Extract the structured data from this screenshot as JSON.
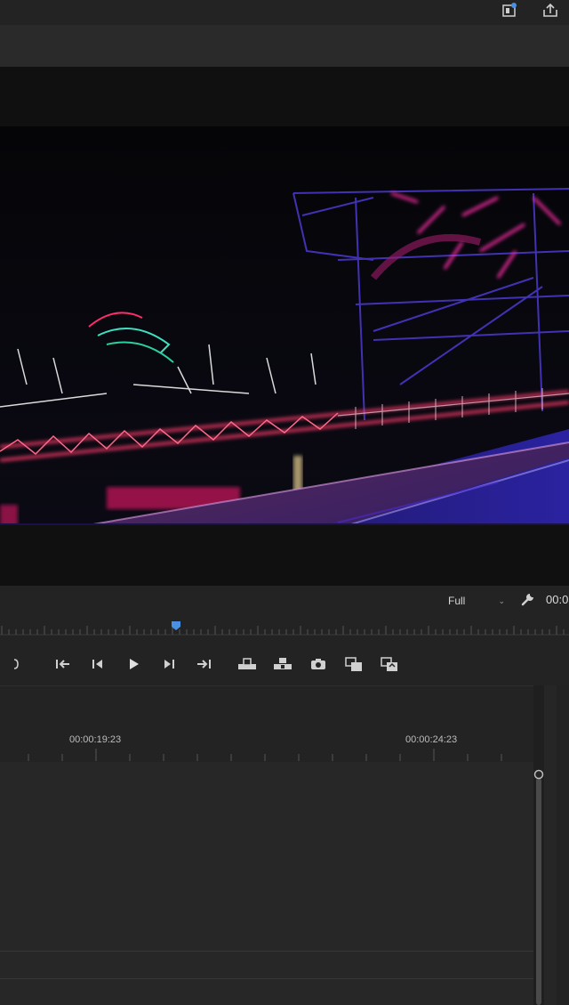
{
  "monitor": {
    "resolution": "Full",
    "timecode": "00:0"
  },
  "playback": {
    "position_fraction": 0.31
  },
  "timeline": {
    "timecodes": [
      "00:00:19:23",
      "00:00:24:23"
    ]
  },
  "icons": [
    "panel-menu-icon",
    "export-icon",
    "wrench-icon",
    "mark-out-icon",
    "go-to-in-icon",
    "step-back-icon",
    "play-icon",
    "step-forward-icon",
    "go-to-out-icon",
    "lift-icon",
    "extract-icon",
    "export-frame-icon",
    "compare-view-icon",
    "toggle-proxies-icon",
    "playhead-icon",
    "scroll-handle-icon"
  ],
  "colors": {
    "accent": "#4a90e2",
    "panel_bg": "#232323",
    "monitor_bg": "#101010"
  }
}
